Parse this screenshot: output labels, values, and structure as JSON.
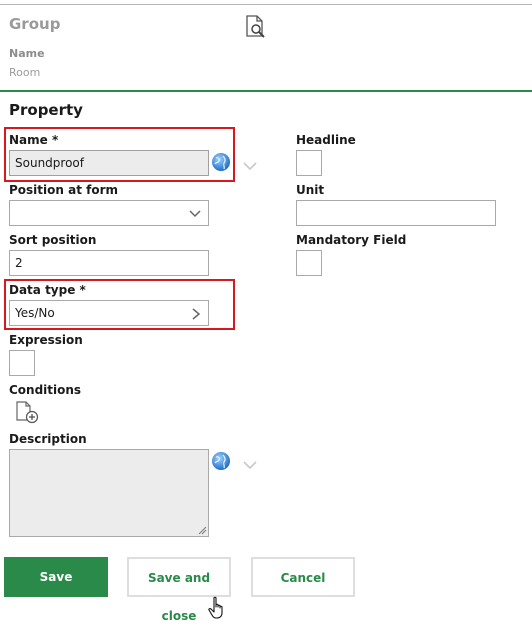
{
  "group": {
    "title": "Group",
    "name_label": "Name",
    "name_value": "Room"
  },
  "property": {
    "title": "Property",
    "name_label": "Name *",
    "name_value": "Soundproof",
    "headline_label": "Headline",
    "position_label": "Position at form",
    "position_value": "",
    "unit_label": "Unit",
    "unit_value": "",
    "sort_label": "Sort position",
    "sort_value": "2",
    "mandatory_label": "Mandatory Field",
    "datatype_label": "Data type *",
    "datatype_value": "Yes/No",
    "expression_label": "Expression",
    "conditions_label": "Conditions",
    "description_label": "Description",
    "description_value": ""
  },
  "buttons": {
    "save": "Save",
    "save_close": "Save and close",
    "cancel": "Cancel"
  },
  "colors": {
    "accent_green": "#2a8a4a",
    "required_highlight": "#d7191f"
  },
  "icons": [
    "document-search-icon",
    "globe-icon",
    "chevron-down-icon",
    "chevron-right-icon",
    "add-document-icon",
    "hand-cursor-icon"
  ]
}
